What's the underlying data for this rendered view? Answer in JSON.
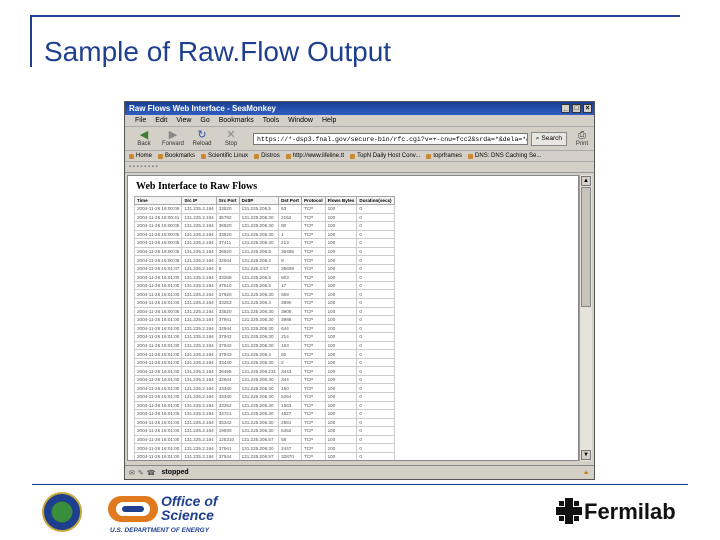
{
  "slide": {
    "title": "Sample of Raw.Flow Output"
  },
  "browser": {
    "window_title": "Raw Flows Web Interface - SeaMonkey",
    "menu": [
      "File",
      "Edit",
      "View",
      "Go",
      "Bookmarks",
      "Tools",
      "Window",
      "Help"
    ],
    "nav": {
      "back": "Back",
      "forward": "Forward",
      "reload": "Reload",
      "stop": "Stop",
      "url": "https://*-dsp3.fnal.gov/secure-bin/rfc.cgi?v=+-cnu=fcc2&srda=*&dela=*&scl=",
      "search": "Search",
      "print": "Print"
    },
    "bookmarks": [
      "Home",
      "Bookmarks",
      "Scientific Linux",
      "Distros",
      "http://www.lifeline.tt",
      "TopN Daily Host Conv...",
      "toprframes",
      "DNS: DNS Caching Se..."
    ],
    "status": "stopped",
    "page": {
      "heading": "Web Interface to Raw Flows",
      "columns": [
        "Time",
        "Src IP",
        "Src Port",
        "DstIP",
        "Dst Port",
        "Protocol",
        "Flows Bytes",
        "Duration(secs)"
      ],
      "rows": [
        [
          "2004-11-26 16:00:05",
          "131.225.2.164",
          "33520",
          "131.225.206.5",
          "53",
          "TCP",
          "100",
          "0"
        ],
        [
          "2004-11-26 18:06:41",
          "131.225.2.164",
          "35792",
          "131.225.206.30",
          "2152",
          "TCP",
          "100",
          "0"
        ],
        [
          "2004-11-26 16:00:05",
          "131.225.2.164",
          "36520",
          "131.225.206.30",
          "80",
          "TCP",
          "100",
          "0"
        ],
        [
          "2004-11-26 16:00:05",
          "131.225.2.164",
          "33520",
          "131.225.206.30",
          "1",
          "TCP",
          "100",
          "0"
        ],
        [
          "2004-11-26 18:00:05",
          "131.225.2.164",
          "37411",
          "131.225.206.30",
          "213",
          "TCP",
          "100",
          "0"
        ],
        [
          "2004-11-26 18:00:05",
          "131.225.2.164",
          "36520",
          "131.225.206.5",
          "36485",
          "TCP",
          "100",
          "0"
        ],
        [
          "2004-11-26 16:00:09",
          "131.225.2.164",
          "32944",
          "131.225.206.4",
          "8",
          "TCP",
          "100",
          "0"
        ],
        [
          "2004-11-26 16:01:07",
          "131.225.2.164",
          "8",
          "131.225.2.57",
          "35608",
          "TCP",
          "100",
          "0"
        ],
        [
          "2004-11-26 16:01:00",
          "131.225.2.164",
          "33268",
          "131.225.206.5",
          "503",
          "TCP",
          "100",
          "0"
        ],
        [
          "2004-11-26 16:01:00",
          "131.225.2.164",
          "47510",
          "131.225.206.5",
          "17",
          "TCP",
          "100",
          "0"
        ],
        [
          "2004-11-26 16:01:00",
          "131.225.2.164",
          "37920",
          "131.225.206.30",
          "559",
          "TCP",
          "100",
          "0"
        ],
        [
          "2004-11-26 16:01:00",
          "131.225.2.164",
          "33253",
          "131.225.206.4",
          "3990",
          "TCP",
          "100",
          "0"
        ],
        [
          "2004-11-26 16:00:05",
          "131.225.2.164",
          "33520",
          "131.225.206.30",
          "3908",
          "TCP",
          "100",
          "0"
        ],
        [
          "2004-11-26 16:01:00",
          "131.225.2.164",
          "37941",
          "131.225.206.30",
          "3988",
          "TCP",
          "100",
          "0"
        ],
        [
          "2004-11-26 16:01:00",
          "131.225.2.164",
          "32944",
          "131.225.206.30",
          "644",
          "TCP",
          "100",
          "0"
        ],
        [
          "2004-11-26 16:01:00",
          "131.225.2.164",
          "37942",
          "131.225.206.30",
          "214",
          "TCP",
          "100",
          "0"
        ],
        [
          "2004-11-26 16:01:00",
          "131.225.2.164",
          "37942",
          "131.225.206.30",
          "163",
          "TCP",
          "100",
          "0"
        ],
        [
          "2004-11-26 16:01:00",
          "131.225.2.164",
          "37943",
          "131.225.206.4",
          "50",
          "TCP",
          "100",
          "0"
        ],
        [
          "2004-11-26 16:01:00",
          "131.225.2.164",
          "33440",
          "131.225.206.30",
          "2",
          "TCP",
          "100",
          "0"
        ],
        [
          "2004-11-26 16:01:00",
          "131.225.2.164",
          "36495",
          "131.225.206.231",
          "3443",
          "TCP",
          "100",
          "0"
        ],
        [
          "2004-11-26 16:01:00",
          "131.225.2.164",
          "32944",
          "131.225.206.30",
          "344",
          "TCP",
          "100",
          "0"
        ],
        [
          "2004-11-26 16:01:00",
          "131.225.2.164",
          "33340",
          "131.225.206.30",
          "150",
          "TCP",
          "100",
          "0"
        ],
        [
          "2004-11-26 16:01:00",
          "131.225.2.164",
          "33340",
          "131.225.206.30",
          "5254",
          "TCP",
          "100",
          "0"
        ],
        [
          "2004-11-26 16:01:00",
          "131.225.2.164",
          "33252",
          "131.225.206.30",
          "1563",
          "TCP",
          "100",
          "0"
        ],
        [
          "2004-11-26 16:01:05",
          "131.225.2.164",
          "34721",
          "131.225.206.30",
          "4527",
          "TCP",
          "100",
          "0"
        ],
        [
          "2004-11-26 16:01:00",
          "131.225.2.164",
          "35342",
          "131.225.206.30",
          "2551",
          "TCP",
          "100",
          "0"
        ],
        [
          "2004-11-26 16:01:00",
          "131.225.2.164",
          "19930",
          "131.225.206.30",
          "5452",
          "TCP",
          "100",
          "0"
        ],
        [
          "2004-11-26 16:01:00",
          "131.225.2.164",
          "125310",
          "131.225.206.57",
          "58",
          "TCP",
          "100",
          "0"
        ],
        [
          "2004-11-26 16:01:00",
          "131.225.2.164",
          "37941",
          "131.225.206.30",
          "2447",
          "TCP",
          "100",
          "0"
        ],
        [
          "2004-11-26 16:01:00",
          "131.225.2.164",
          "37544",
          "131.225.206.57",
          "32870",
          "TCP",
          "100",
          "0"
        ],
        [
          "2004-11-26 16:01:00",
          "131.225.2.164",
          "25130",
          "131.225.206.30",
          "4987",
          "TCP",
          "100",
          "0"
        ],
        [
          "2004-11-26 16:01:00",
          "131.225.2.164",
          "397",
          "131.225.2.57",
          "32264",
          "TCP",
          "100",
          "0"
        ]
      ]
    }
  },
  "footer": {
    "office_of_science_line1": "Office of",
    "office_of_science_line2": "Science",
    "doe": "U.S. DEPARTMENT OF ENERGY",
    "fermilab": "Fermilab"
  },
  "colors": {
    "title_blue": "#1f3f8f",
    "oos_orange": "#e07a1f",
    "fermi_black": "#111111"
  }
}
